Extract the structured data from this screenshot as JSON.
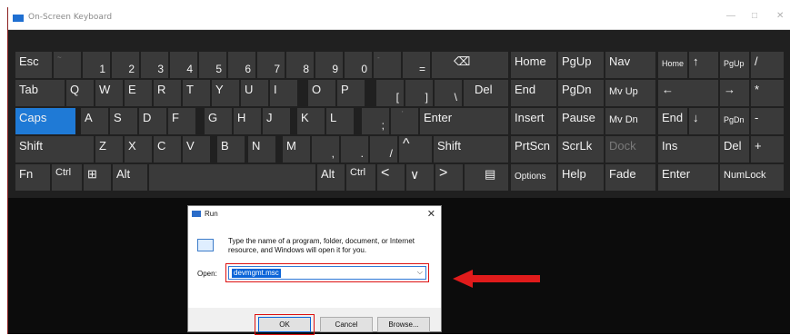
{
  "osk": {
    "title": "On-Screen Keyboard",
    "controls": {
      "minimize": "—",
      "maximize": "□",
      "close": "✕"
    },
    "rows": [
      [
        "Esc",
        "~",
        "1",
        "2",
        "3",
        "4",
        "5",
        "6",
        "7",
        "8",
        "9",
        "0",
        "-",
        "=",
        "⌫",
        "Home",
        "PgUp",
        "Nav",
        "Home",
        "↑",
        "PgUp",
        "/"
      ],
      [
        "Tab",
        "Q",
        "W",
        "E",
        "R",
        "T",
        "Y",
        "U",
        "I",
        "O",
        "P",
        "[",
        "]",
        "\\",
        "Del",
        "End",
        "PgDn",
        "Mv Up",
        "←",
        "→",
        "*"
      ],
      [
        "Caps",
        "A",
        "S",
        "D",
        "F",
        "G",
        "H",
        "J",
        "K",
        "L",
        ";",
        "'",
        "Enter",
        "Insert",
        "Pause",
        "Mv Dn",
        "End",
        "↓",
        "PgDn",
        "-"
      ],
      [
        "Shift",
        "Z",
        "X",
        "C",
        "V",
        "B",
        "N",
        "M",
        ",",
        ".",
        "/",
        "^",
        "Shift",
        "PrtScn",
        "ScrLk",
        "Dock",
        "Ins",
        "Del",
        "+"
      ],
      [
        "Fn",
        "Ctrl",
        "⊞",
        "Alt",
        "",
        "Alt",
        "Ctrl",
        "<",
        "∨",
        ">",
        "▤",
        "Options",
        "Help",
        "Fade",
        "Enter",
        "NumLock"
      ]
    ]
  },
  "run_dialog": {
    "title": "Run",
    "close": "✕",
    "description": "Type the name of a program, folder, document, or Internet resource, and Windows will open it for you.",
    "open_label": "Open:",
    "open_value": "devmgmt.msc",
    "ok": "OK",
    "cancel": "Cancel",
    "browse": "Browse..."
  },
  "colors": {
    "highlight": "#d11111",
    "accent": "#1f7ad6"
  }
}
